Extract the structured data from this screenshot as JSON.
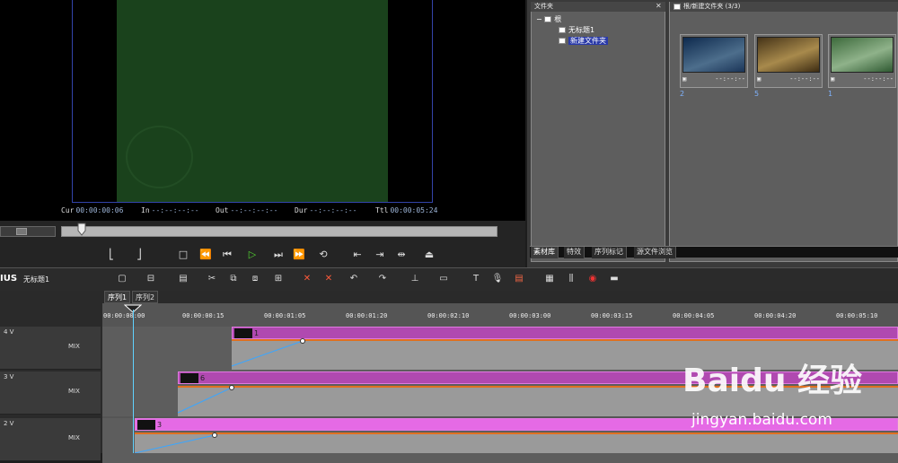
{
  "player": {
    "timecodes": [
      {
        "label": "Cur",
        "value": "00:00:00:06"
      },
      {
        "label": "In",
        "value": "--:--:--:--"
      },
      {
        "label": "Out",
        "value": "--:--:--:--"
      },
      {
        "label": "Dur",
        "value": "--:--:--:--"
      },
      {
        "label": "Ttl",
        "value": "00:00:05:24"
      }
    ]
  },
  "folder_panel": {
    "title": "文件夹",
    "root": "根",
    "items": [
      "无标题1",
      "新建文件夹"
    ]
  },
  "bin_panel": {
    "title": "根/新建文件夹 (3/3)",
    "clips": [
      {
        "number": "2",
        "timecode": "--:--:--"
      },
      {
        "number": "5",
        "timecode": "--:--:--"
      },
      {
        "number": "1",
        "timecode": "--:--:--"
      }
    ]
  },
  "tabs": [
    "素材库",
    "特效",
    "序列标记",
    "源文件浏览"
  ],
  "app": {
    "name": "IUS",
    "project": "无标题1"
  },
  "sequences": [
    "序列1",
    "序列2"
  ],
  "ruler": {
    "labels": [
      "00:00:00:00",
      "00:00:00:15",
      "00:00:01:05",
      "00:00:01:20",
      "00:00:02:10",
      "00:00:03:00",
      "00:00:03:15",
      "00:00:04:05",
      "00:00:04:20",
      "00:00:05:10"
    ]
  },
  "tracks": [
    {
      "label": "4 V",
      "clip": "1",
      "mix": "MIX"
    },
    {
      "label": "3 V",
      "clip": "6",
      "mix": "MIX"
    },
    {
      "label": "2 V",
      "clip": "3",
      "mix": "MIX"
    }
  ],
  "watermark": {
    "logo": "Bai du 经验",
    "url": "jingyan.baidu.com"
  },
  "colors": {
    "accent": "#2a3aa8",
    "clip": "#b049b0",
    "play": "#53d332"
  }
}
